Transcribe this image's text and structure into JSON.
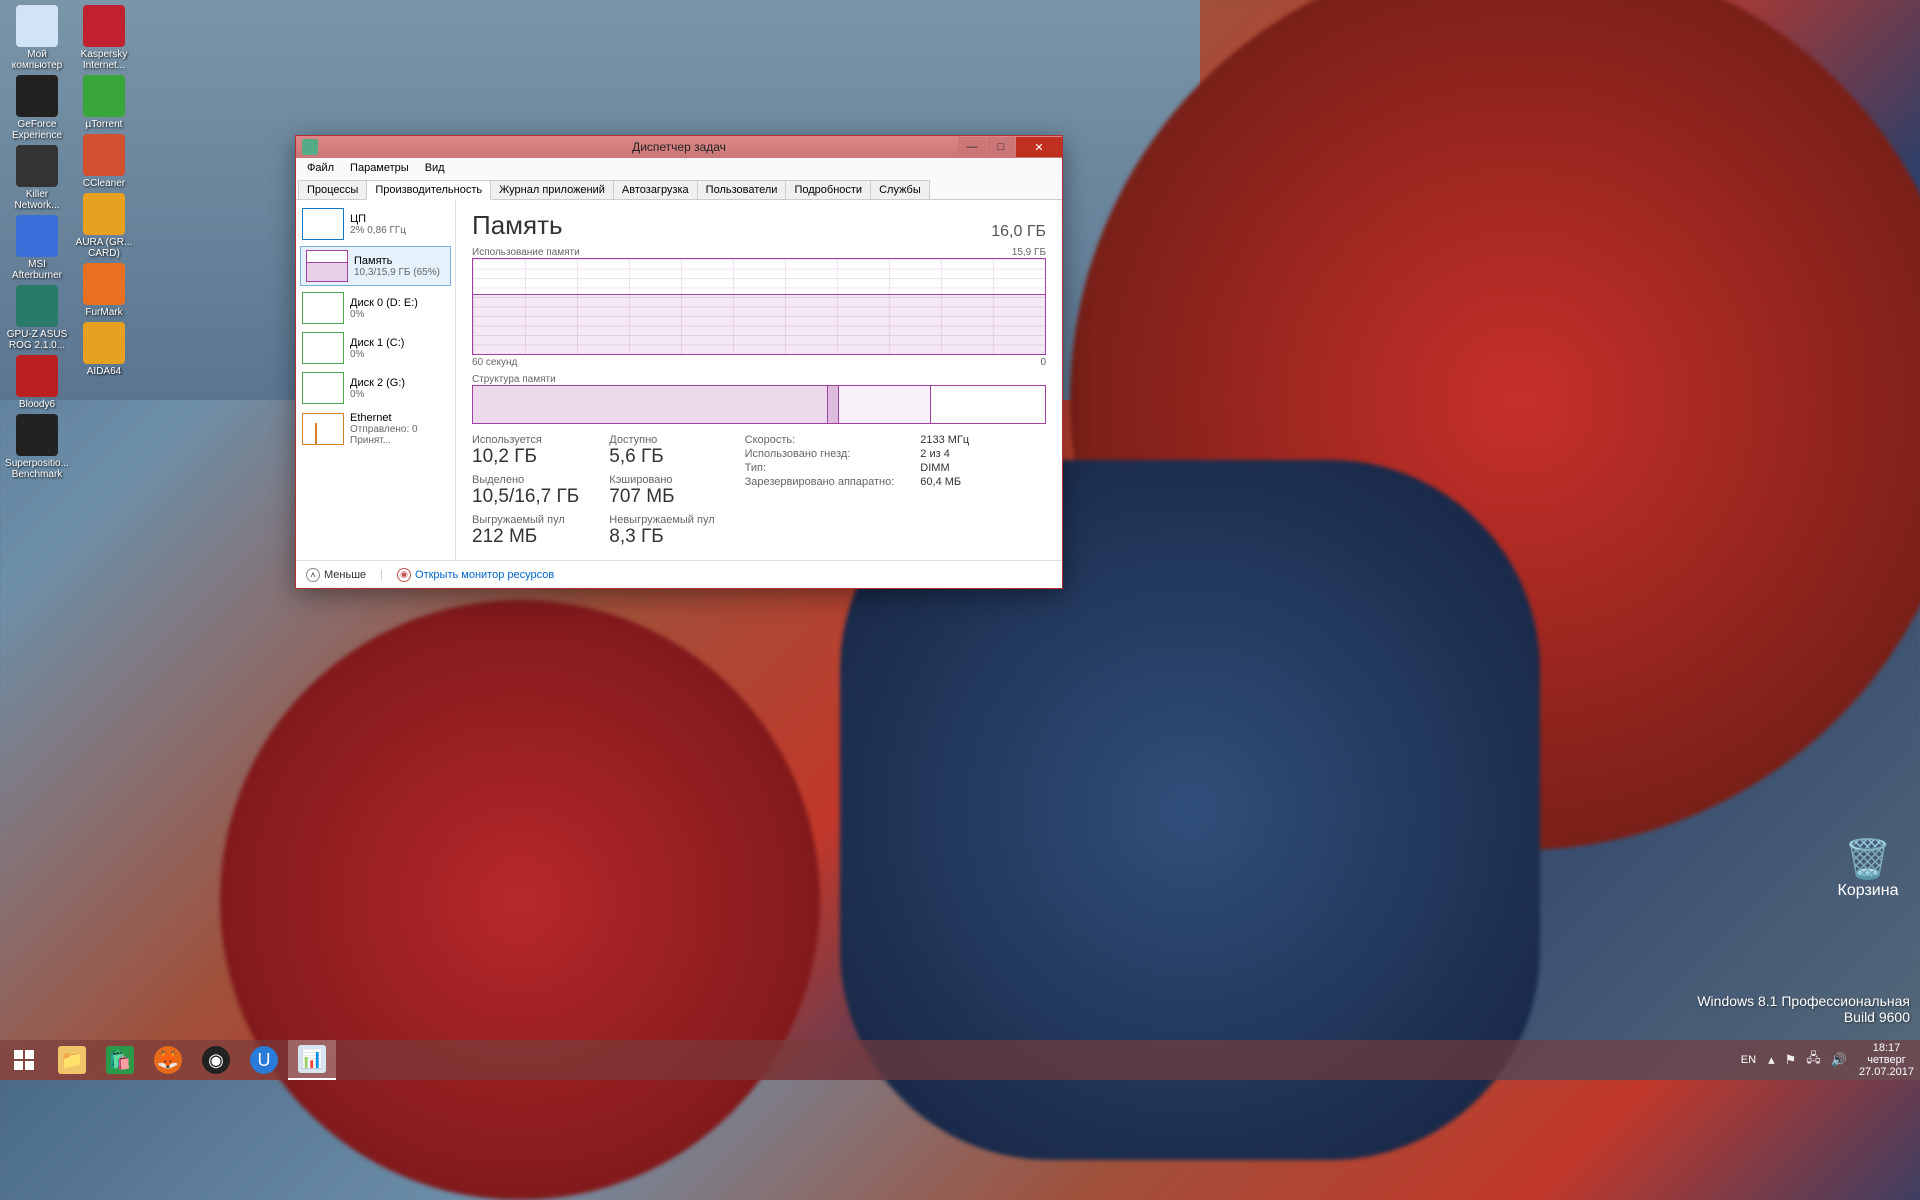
{
  "desktop_icons_col1": [
    {
      "label": "Мой компьютер",
      "color": "#d0e4f5"
    },
    {
      "label": "GeForce Experience",
      "color": "#222"
    },
    {
      "label": "Killer Network...",
      "color": "#333"
    },
    {
      "label": "MSI Afterburner",
      "color": "#3a6ed8"
    },
    {
      "label": "GPU-Z ASUS ROG 2.1.0...",
      "color": "#2a7a6a"
    },
    {
      "label": "Bloody6",
      "color": "#bb2020"
    },
    {
      "label": "Superpositio... Benchmark",
      "color": "#222"
    }
  ],
  "desktop_icons_col2": [
    {
      "label": "Kaspersky Internet...",
      "color": "#c02030"
    },
    {
      "label": "µTorrent",
      "color": "#3aa53a"
    },
    {
      "label": "CCleaner",
      "color": "#d05030"
    },
    {
      "label": "AURA (GR... CARD)",
      "color": "#e8a020"
    },
    {
      "label": "FurMark",
      "color": "#e87020"
    },
    {
      "label": "AIDA64",
      "color": "#e8a020"
    }
  ],
  "recycle_bin_label": "Корзина",
  "watermark": {
    "line1": "Windows 8.1 Профессиональная",
    "line2": "Build 9600"
  },
  "taskbar": {
    "lang": "EN",
    "time": "18:17",
    "day": "четверг",
    "date": "27.07.2017"
  },
  "window": {
    "title": "Диспетчер задач",
    "menu": [
      "Файл",
      "Параметры",
      "Вид"
    ],
    "tabs": [
      "Процессы",
      "Производительность",
      "Журнал приложений",
      "Автозагрузка",
      "Пользователи",
      "Подробности",
      "Службы"
    ],
    "active_tab_index": 1,
    "sidebar": [
      {
        "key": "cpu",
        "title": "ЦП",
        "sub": "2% 0,86 ГГц"
      },
      {
        "key": "mem",
        "title": "Память",
        "sub": "10,3/15,9 ГБ (65%)"
      },
      {
        "key": "d0",
        "title": "Диск 0 (D: E:)",
        "sub": "0%"
      },
      {
        "key": "d1",
        "title": "Диск 1 (C:)",
        "sub": "0%"
      },
      {
        "key": "d2",
        "title": "Диск 2 (G:)",
        "sub": "0%"
      },
      {
        "key": "eth",
        "title": "Ethernet",
        "sub": "Отправлено: 0 Принят..."
      }
    ],
    "selected_sidebar": 1,
    "main": {
      "heading": "Память",
      "total": "16,0 ГБ",
      "chart_title": "Использование памяти",
      "chart_max": "15,9 ГБ",
      "chart_xaxis_left": "60 секунд",
      "chart_xaxis_right": "0",
      "struct_title": "Структура памяти",
      "stats": [
        {
          "label": "Используется",
          "value": "10,2 ГБ"
        },
        {
          "label": "Доступно",
          "value": "5,6 ГБ"
        },
        {
          "label": "Выделено",
          "value": "10,5/16,7 ГБ"
        },
        {
          "label": "Кэшировано",
          "value": "707 МБ"
        },
        {
          "label": "Выгружаемый пул",
          "value": "212 МБ"
        },
        {
          "label": "Невыгружаемый пул",
          "value": "8,3 ГБ"
        }
      ],
      "kv": [
        {
          "k": "Скорость:",
          "v": "2133 МГц"
        },
        {
          "k": "Использовано гнезд:",
          "v": "2 из 4"
        },
        {
          "k": "Тип:",
          "v": "DIMM"
        },
        {
          "k": "Зарезервировано аппаратно:",
          "v": "60,4 МБ"
        }
      ]
    },
    "footer": {
      "less": "Меньше",
      "monitor": "Открыть монитор ресурсов"
    }
  },
  "chart_data": {
    "type": "line",
    "title": "Использование памяти",
    "ylabel": "ГБ",
    "ylim": [
      0,
      15.9
    ],
    "x_seconds": [
      60,
      55,
      50,
      45,
      40,
      35,
      30,
      25,
      20,
      15,
      10,
      5,
      0
    ],
    "series": [
      {
        "name": "Память",
        "values": [
          10.2,
          10.2,
          10.3,
          10.3,
          10.3,
          10.2,
          10.3,
          10.3,
          10.3,
          10.2,
          10.3,
          10.3,
          10.3
        ]
      }
    ],
    "current_used_gb": 10.2,
    "total_gb": 16.0,
    "percent": 65
  }
}
